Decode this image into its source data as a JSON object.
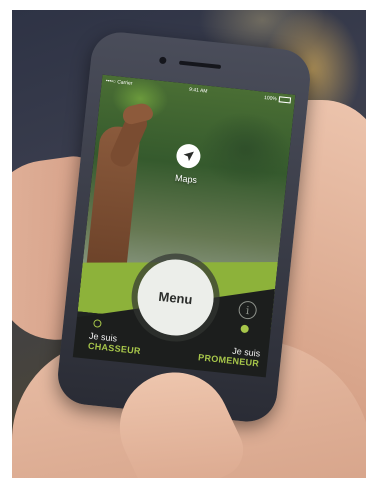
{
  "status_bar": {
    "carrier": "••••○ Carrier",
    "time": "9:41 AM",
    "battery": "100%"
  },
  "maps": {
    "label": "Maps",
    "icon": "navigation-arrow-icon"
  },
  "menu": {
    "label": "Menu"
  },
  "info": {
    "label": "i",
    "icon": "info-icon"
  },
  "choices": {
    "chasseur": {
      "line1": "Je suis",
      "line2": "CHASSEUR",
      "selected": false
    },
    "promeneur": {
      "line1": "Je suis",
      "line2": "PROMENEUR",
      "selected": true
    }
  },
  "colors": {
    "accent_green": "#a7c64a",
    "band_green": "#8db23a",
    "dark_panel": "#1c1e1d",
    "menu_button": "#eceeea"
  }
}
